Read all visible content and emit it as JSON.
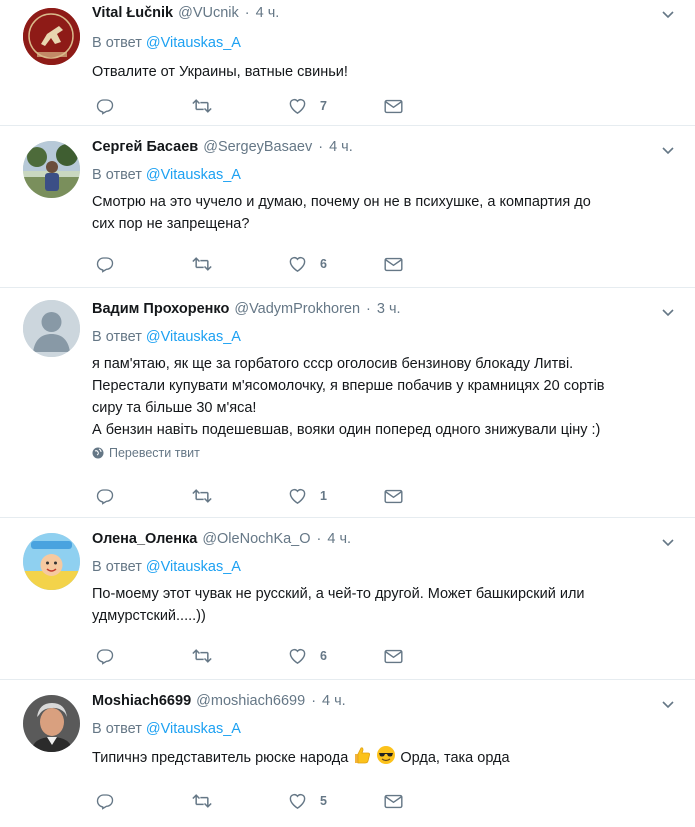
{
  "reply_prefix": "В ответ",
  "translate_label": "Перевести твит",
  "tweets": [
    {
      "name": "Vital Łučnik",
      "handle": "@VUcnik",
      "time": "4 ч.",
      "reply_to": "@Vitauskas_A",
      "text_lines": [
        "Отвалите от Украины, ватные свиньи!"
      ],
      "avatar_icon": "pahonia-crest-avatar",
      "like_count": "7",
      "has_translate": false
    },
    {
      "name": "Сергей Басаев",
      "handle": "@SergeyBasaev",
      "time": "4 ч.",
      "reply_to": "@Vitauskas_A",
      "text_lines": [
        "Смотрю на это чучело и думаю, почему он не в психушке, а компартия до",
        "сих пор не запрещена?"
      ],
      "avatar_icon": "photo-avatar",
      "like_count": "6",
      "has_translate": false
    },
    {
      "name": "Вадим Прохоренко",
      "handle": "@VadymProkhoren",
      "time": "3 ч.",
      "reply_to": "@Vitauskas_A",
      "text_lines": [
        "я пам'ятаю, як ще за горбатого ссср оголосив бензинову блокаду Литві.",
        "Перестали купувати м'ясомолочку, я вперше побачив у крамницях 20 сортів",
        "сиру та більше 30 м'яса!",
        "А бензин навіть подешевшав, вояки один поперед одного знижували ціну :)"
      ],
      "avatar_icon": "default-avatar",
      "like_count": "1",
      "has_translate": true
    },
    {
      "name": "Олена_Оленка",
      "handle": "@OleNochKa_O",
      "time": "4 ч.",
      "reply_to": "@Vitauskas_A",
      "text_lines": [
        "По-моему этот чувак не русский, а чей-то другой. Может башкирский или",
        "удмурстский.....))"
      ],
      "avatar_icon": "child-avatar",
      "like_count": "6",
      "has_translate": false
    },
    {
      "name": "Moshiach6699",
      "handle": "@moshiach6699",
      "time": "4 ч.",
      "reply_to": "@Vitauskas_A",
      "text_lines": [
        "Типичнэ представитель рюске народа",
        "Орда, така орда"
      ],
      "avatar_icon": "man-photo-avatar",
      "like_count": "5",
      "has_translate": false
    }
  ],
  "colors": {
    "accent": "#1da1f2",
    "muted": "#657786",
    "border": "#e6ecf0"
  }
}
